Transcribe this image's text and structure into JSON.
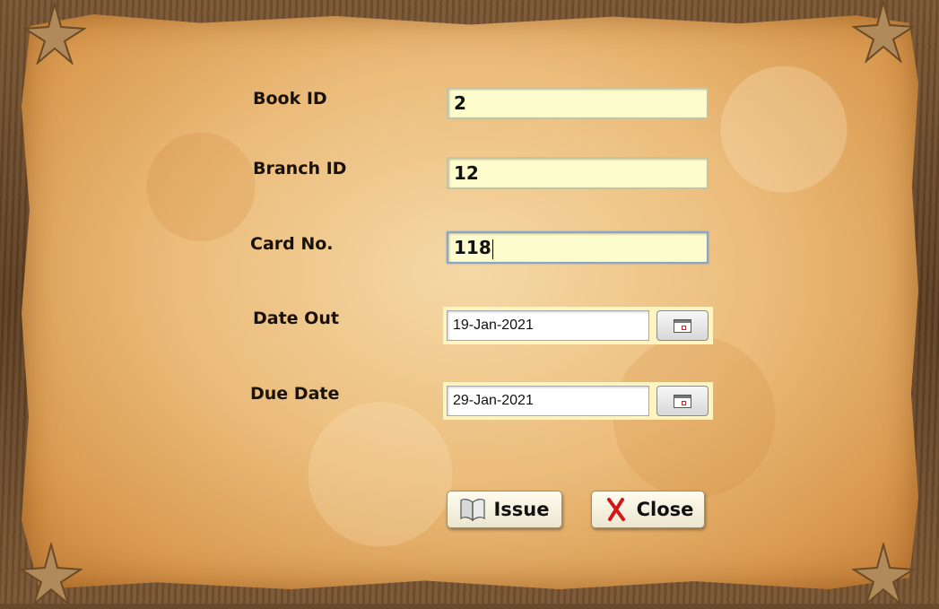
{
  "form": {
    "book_id": {
      "label": "Book ID",
      "value": "2"
    },
    "branch_id": {
      "label": "Branch ID",
      "value": "12"
    },
    "card_no": {
      "label": "Card No.",
      "value": "118"
    },
    "date_out": {
      "label": "Date Out",
      "value": "19-Jan-2021"
    },
    "due_date": {
      "label": "Due Date",
      "value": "29-Jan-2021"
    }
  },
  "buttons": {
    "issue": {
      "label": "Issue",
      "icon": "book-icon"
    },
    "close": {
      "label": "Close",
      "icon": "close-x-icon"
    }
  },
  "colors": {
    "input_bg": "#fdfccc",
    "parchment": "#ecbd7c",
    "close_x": "#d01818"
  }
}
